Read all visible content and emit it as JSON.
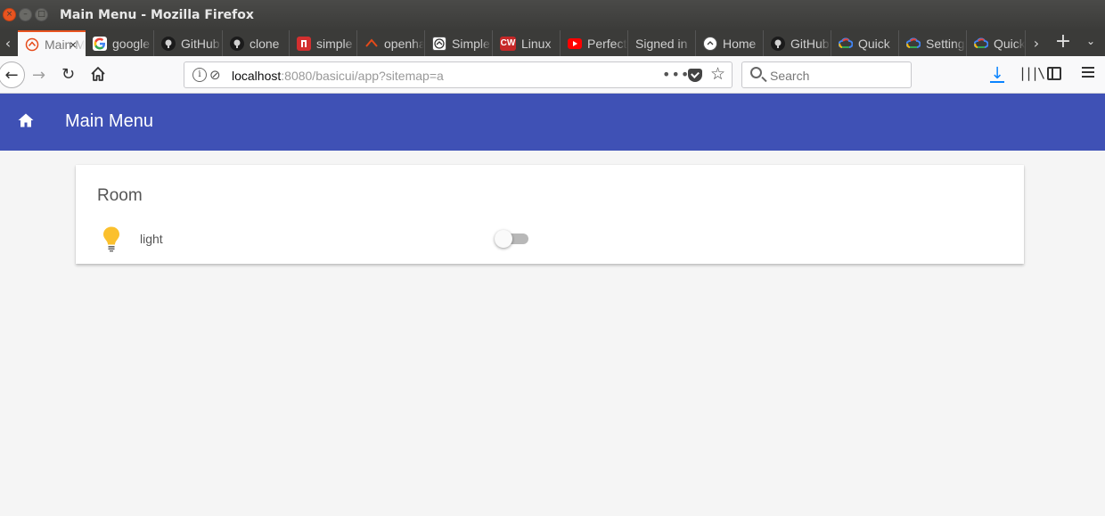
{
  "window": {
    "title": "Main Menu - Mozilla Firefox",
    "close_glyph": "×",
    "min_glyph": "–",
    "max_glyph": "□"
  },
  "tabs": [
    {
      "label": "Main Menu",
      "icon": "openhab-icon",
      "active": true
    },
    {
      "label": "google",
      "icon": "google-icon"
    },
    {
      "label": "GitHub",
      "icon": "github-icon"
    },
    {
      "label": "clone",
      "icon": "github-icon"
    },
    {
      "label": "simple",
      "icon": "red-square-icon"
    },
    {
      "label": "openhab",
      "icon": "openhab-red-icon"
    },
    {
      "label": "Simple",
      "icon": "openhab-icon"
    },
    {
      "label": "Linux",
      "icon": "cw-icon",
      "fav_text": "CW"
    },
    {
      "label": "Perfect",
      "icon": "youtube-icon"
    },
    {
      "label": "Signed in",
      "icon": ""
    },
    {
      "label": "Home",
      "icon": "openhab-icon"
    },
    {
      "label": "GitHub",
      "icon": "github-icon"
    },
    {
      "label": "Quick",
      "icon": "gcloud-icon"
    },
    {
      "label": "Settings",
      "icon": "gcloud-icon"
    },
    {
      "label": "Quick",
      "icon": "gcloud-icon"
    }
  ],
  "tabstrip": {
    "scroll_left": "‹",
    "scroll_right": "›",
    "new_tab": "+",
    "list_tabs": "⌄",
    "tab_close": "×"
  },
  "nav": {
    "back": "←",
    "forward": "→",
    "reload": "↻",
    "url_host": "localhost",
    "url_rest": ":8080/basicui/app?sitemap=a",
    "url_info": "i",
    "url_tracking": "⊘",
    "url_more": "•••",
    "url_star": "☆",
    "search_placeholder": "Search",
    "download": "↓",
    "library": "|||\\"
  },
  "app": {
    "title": "Main Menu",
    "header_color": "#3f51b5"
  },
  "frame": {
    "title": "Room",
    "items": [
      {
        "label": "light",
        "icon": "lightbulb-icon",
        "switch_on": false
      }
    ]
  },
  "colors": {
    "accent_orange": "#e95420",
    "bulb": "#fbc02d",
    "download_blue": "#0a84ff"
  }
}
